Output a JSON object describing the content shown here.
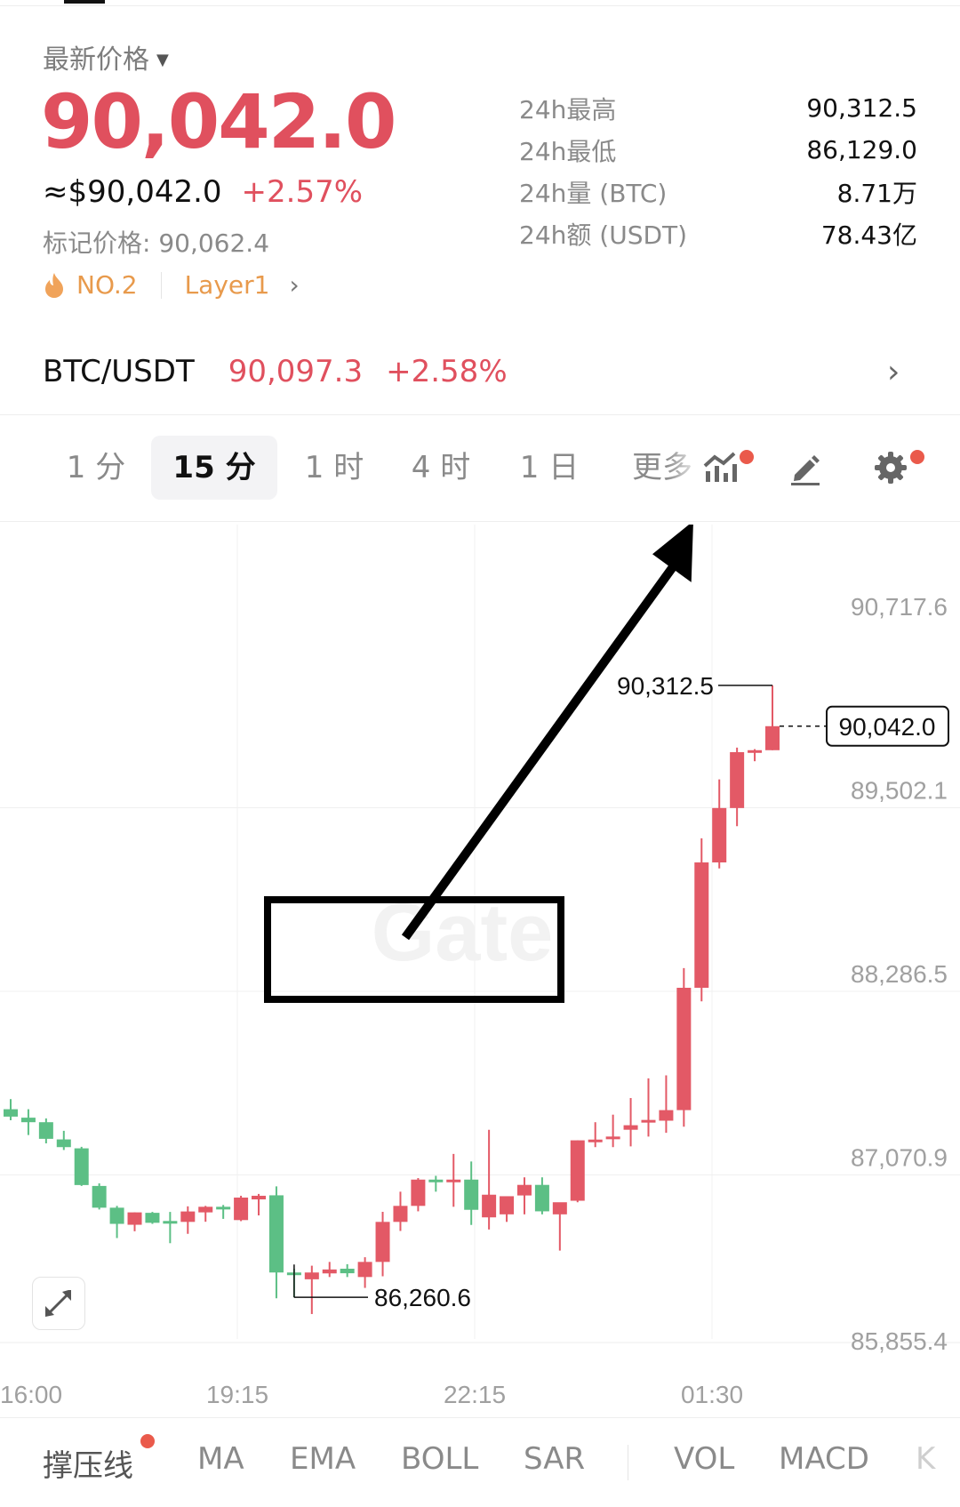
{
  "header": {
    "latest_label": "最新价格",
    "last_price": "90,042.0",
    "usd_value": "≈$90,042.0",
    "change_pct": "+2.57%",
    "mark_price": "标记价格: 90,062.4",
    "rank": "NO.2",
    "category": "Layer1"
  },
  "stats": [
    {
      "label": "24h最高",
      "value": "90,312.5"
    },
    {
      "label": "24h最低",
      "value": "86,129.0"
    },
    {
      "label": "24h量 (BTC)",
      "value": "8.71万"
    },
    {
      "label": "24h额 (USDT)",
      "value": "78.43亿"
    }
  ],
  "pair": {
    "name": "BTC/USDT",
    "price": "90,097.3",
    "change": "+2.58%"
  },
  "timeframes": [
    "1 分",
    "15 分",
    "1 时",
    "4 时",
    "1 日",
    "更多"
  ],
  "active_timeframe": "15 分",
  "indicators": [
    "撑压线",
    "MA",
    "EMA",
    "BOLL",
    "SAR",
    "VOL",
    "MACD",
    "K"
  ],
  "colors": {
    "up": "#e35966",
    "down": "#5cbf85",
    "accent_dot": "#ea5a4b",
    "brand_text": "#e89a4c"
  },
  "icons": [
    "caret-down-icon",
    "fire-icon",
    "chevron-right-icon",
    "indicator-icon",
    "draw-icon",
    "settings-icon",
    "expand-icon"
  ],
  "chart_data": {
    "type": "candlestick",
    "y_ticks": [
      "90,717.6",
      "89,502.1",
      "88,286.5",
      "87,070.9",
      "85,855.4"
    ],
    "ylim": [
      85855.4,
      90717.6
    ],
    "x_ticks": [
      "16:00",
      "19:15",
      "22:15",
      "01:30"
    ],
    "watermark": "Gate",
    "high_marker": "90,312.5",
    "low_marker": "86,260.6",
    "current_price_label": "90,042.0",
    "annotation": "black arrow pointing up-right from the low-price box toward the latest price",
    "candles": [
      {
        "o": 87506,
        "h": 87573,
        "l": 87433,
        "c": 87457
      },
      {
        "o": 87450,
        "h": 87506,
        "l": 87335,
        "c": 87420
      },
      {
        "o": 87420,
        "h": 87445,
        "l": 87280,
        "c": 87310
      },
      {
        "o": 87306,
        "h": 87363,
        "l": 87236,
        "c": 87255
      },
      {
        "o": 87247,
        "h": 87257,
        "l": 86998,
        "c": 87004
      },
      {
        "o": 86998,
        "h": 87015,
        "l": 86842,
        "c": 86854
      },
      {
        "o": 86854,
        "h": 86866,
        "l": 86653,
        "c": 86747
      },
      {
        "o": 86741,
        "h": 86823,
        "l": 86698,
        "c": 86823
      },
      {
        "o": 86820,
        "h": 86826,
        "l": 86747,
        "c": 86754
      },
      {
        "o": 86766,
        "h": 86826,
        "l": 86619,
        "c": 86754
      },
      {
        "o": 86760,
        "h": 86863,
        "l": 86681,
        "c": 86829
      },
      {
        "o": 86823,
        "h": 86866,
        "l": 86761,
        "c": 86860
      },
      {
        "o": 86860,
        "h": 86872,
        "l": 86780,
        "c": 86854
      },
      {
        "o": 86772,
        "h": 86933,
        "l": 86765,
        "c": 86921
      },
      {
        "o": 86909,
        "h": 86945,
        "l": 86803,
        "c": 86933
      },
      {
        "o": 86936,
        "h": 86995,
        "l": 86254,
        "c": 86425
      },
      {
        "o": 86425,
        "h": 86450,
        "l": 86260.6,
        "c": 86419
      },
      {
        "o": 86380,
        "h": 86470,
        "l": 86150,
        "c": 86425
      },
      {
        "o": 86419,
        "h": 86495,
        "l": 86395,
        "c": 86445
      },
      {
        "o": 86450,
        "h": 86480,
        "l": 86395,
        "c": 86420
      },
      {
        "o": 86395,
        "h": 86526,
        "l": 86323,
        "c": 86495
      },
      {
        "o": 86495,
        "h": 86827,
        "l": 86400,
        "c": 86760
      },
      {
        "o": 86760,
        "h": 86960,
        "l": 86700,
        "c": 86866
      },
      {
        "o": 86866,
        "h": 87050,
        "l": 86830,
        "c": 87040
      },
      {
        "o": 87040,
        "h": 87065,
        "l": 86960,
        "c": 87030
      },
      {
        "o": 87040,
        "h": 87210,
        "l": 86860,
        "c": 87040
      },
      {
        "o": 87040,
        "h": 87160,
        "l": 86740,
        "c": 86840
      },
      {
        "o": 86790,
        "h": 87370,
        "l": 86710,
        "c": 86940
      },
      {
        "o": 86810,
        "h": 86890,
        "l": 86760,
        "c": 86930
      },
      {
        "o": 86935,
        "h": 87055,
        "l": 86810,
        "c": 87005
      },
      {
        "o": 87005,
        "h": 87055,
        "l": 86810,
        "c": 86830
      },
      {
        "o": 86810,
        "h": 86880,
        "l": 86570,
        "c": 86890
      },
      {
        "o": 86900,
        "h": 87300,
        "l": 86890,
        "c": 87300
      },
      {
        "o": 87300,
        "h": 87420,
        "l": 87255,
        "c": 87305
      },
      {
        "o": 87315,
        "h": 87470,
        "l": 87255,
        "c": 87325
      },
      {
        "o": 87370,
        "h": 87580,
        "l": 87260,
        "c": 87400
      },
      {
        "o": 87420,
        "h": 87710,
        "l": 87325,
        "c": 87435
      },
      {
        "o": 87430,
        "h": 87730,
        "l": 87350,
        "c": 87500
      },
      {
        "o": 87500,
        "h": 88440,
        "l": 87390,
        "c": 88310
      },
      {
        "o": 88310,
        "h": 89300,
        "l": 88220,
        "c": 89140
      },
      {
        "o": 89140,
        "h": 89690,
        "l": 89100,
        "c": 89500
      },
      {
        "o": 89500,
        "h": 89900,
        "l": 89380,
        "c": 89870
      },
      {
        "o": 89870,
        "h": 89890,
        "l": 89810,
        "c": 89883
      },
      {
        "o": 89883,
        "h": 90312.5,
        "l": 89883,
        "c": 90042
      }
    ]
  }
}
